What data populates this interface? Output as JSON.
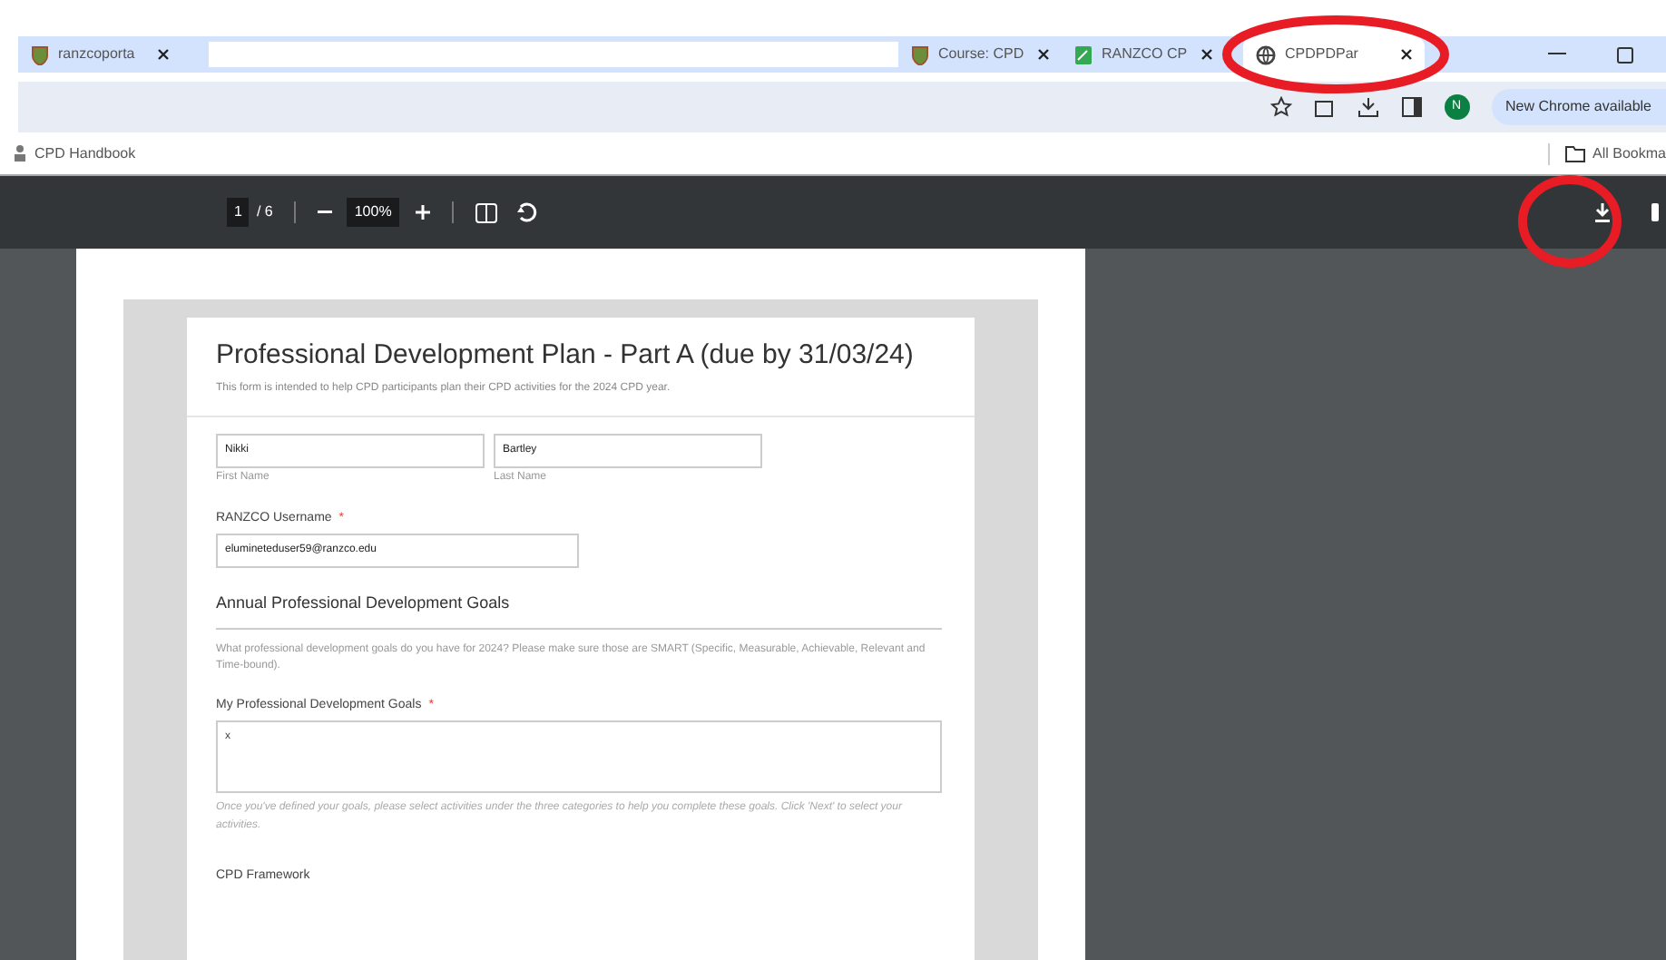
{
  "tabs": [
    {
      "label": "ranzcoporta",
      "selected": false,
      "kind": "crest"
    },
    {
      "label": "Course: CPD",
      "selected": false,
      "kind": "crest"
    },
    {
      "label": "RANZCO CP",
      "selected": false,
      "kind": "sheet"
    },
    {
      "label": "CPDPDPar",
      "selected": true,
      "kind": "globe"
    }
  ],
  "toolbar": {
    "profile_initial": "N",
    "update_button": "New Chrome available"
  },
  "bookmarks": {
    "items": [
      "CPD Handbook"
    ],
    "all_bookmarks": "All Bookma"
  },
  "pdf_toolbar": {
    "page": "1",
    "page_total": "/ 6",
    "zoom": "100%"
  },
  "form": {
    "title": "Professional Development Plan - Part A (due by 31/03/24)",
    "subtitle": "This form is intended to help CPD participants plan their CPD activities for the 2024 CPD year.",
    "first_name": {
      "value": "Nikki",
      "label": "First Name"
    },
    "last_name": {
      "value": "Bartley",
      "label": "Last Name"
    },
    "username": {
      "label": "RANZCO Username",
      "required": true,
      "required_mark": "*",
      "value": "elumineteduser59@ranzco.edu"
    },
    "section_title": "Annual Professional Development Goals",
    "section_text": "What professional development goals do you have for 2024? Please make sure those are SMART (Specific, Measurable, Achievable, Relevant and Time-bound).",
    "goals": {
      "label": "My Professional Development Goals",
      "required": true,
      "required_mark": "*",
      "value": "x"
    },
    "goals_help": "Once you've defined your goals, please select activities under the three categories to help you complete these goals. Click 'Next' to select your activities.",
    "framework_label": "CPD Framework"
  }
}
